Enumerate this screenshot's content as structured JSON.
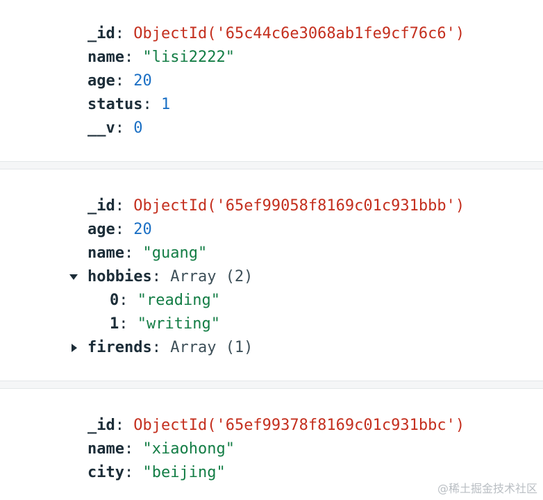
{
  "documents": [
    {
      "fields": [
        {
          "key": "_id",
          "value": "ObjectId('65c44c6e3068ab1fe9cf76c6')"
        },
        {
          "key": "name",
          "value": "\"lisi2222\""
        },
        {
          "key": "age",
          "value": "20"
        },
        {
          "key": "status",
          "value": "1"
        },
        {
          "key": "__v",
          "value": "0"
        }
      ]
    },
    {
      "fields": [
        {
          "key": "_id",
          "value": "ObjectId('65ef99058f8169c01c931bbb')"
        },
        {
          "key": "age",
          "value": "20"
        },
        {
          "key": "name",
          "value": "\"guang\""
        },
        {
          "key": "hobbies",
          "value": "Array (2)",
          "expanded": true,
          "items": [
            {
              "key": "0",
              "value": "\"reading\""
            },
            {
              "key": "1",
              "value": "\"writing\""
            }
          ]
        },
        {
          "key": "firends",
          "value": "Array (1)",
          "expanded": false
        }
      ]
    },
    {
      "fields": [
        {
          "key": "_id",
          "value": "ObjectId('65ef99378f8169c01c931bbc')"
        },
        {
          "key": "name",
          "value": "\"xiaohong\""
        },
        {
          "key": "city",
          "value": "\"beijing\""
        }
      ]
    }
  ],
  "colon": ":",
  "watermark": "@稀土掘金技术社区",
  "colors": {
    "key": "#1c2d38",
    "objectid": "#c42f1e",
    "number": "#1a6fc4",
    "string": "#137d45",
    "type": "#3d4f58",
    "separator": "#f5f6f7"
  },
  "icons": {
    "expanded": "caret-down-icon",
    "collapsed": "caret-right-icon"
  }
}
